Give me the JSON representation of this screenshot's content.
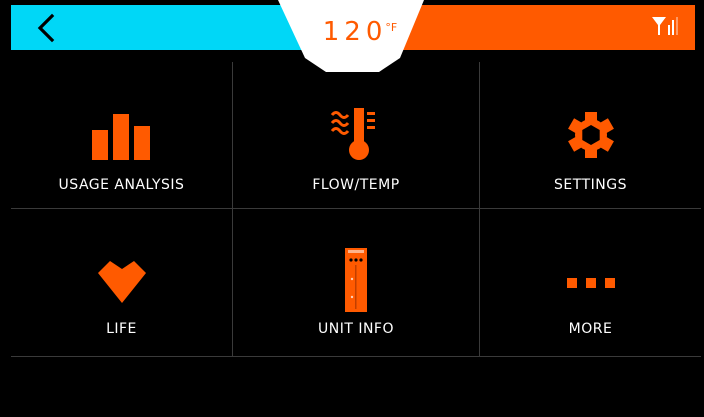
{
  "header": {
    "temperature_value": "120",
    "temperature_unit": "°F",
    "colors": {
      "cold": "#00d7f7",
      "hot": "#ff5a00",
      "accent": "#ff5a00"
    },
    "back_icon": "chevron-left-icon",
    "signal_icon": "signal-icon"
  },
  "menu": {
    "tiles": [
      {
        "label": "USAGE ANALYSIS",
        "icon": "bar-chart-icon"
      },
      {
        "label": "FLOW/TEMP",
        "icon": "flow-temperature-icon"
      },
      {
        "label": "SETTINGS",
        "icon": "gear-icon"
      },
      {
        "label": "LIFE",
        "icon": "heart-icon"
      },
      {
        "label": "UNIT INFO",
        "icon": "unit-device-icon"
      },
      {
        "label": "MORE",
        "icon": "more-dots-icon"
      }
    ]
  }
}
